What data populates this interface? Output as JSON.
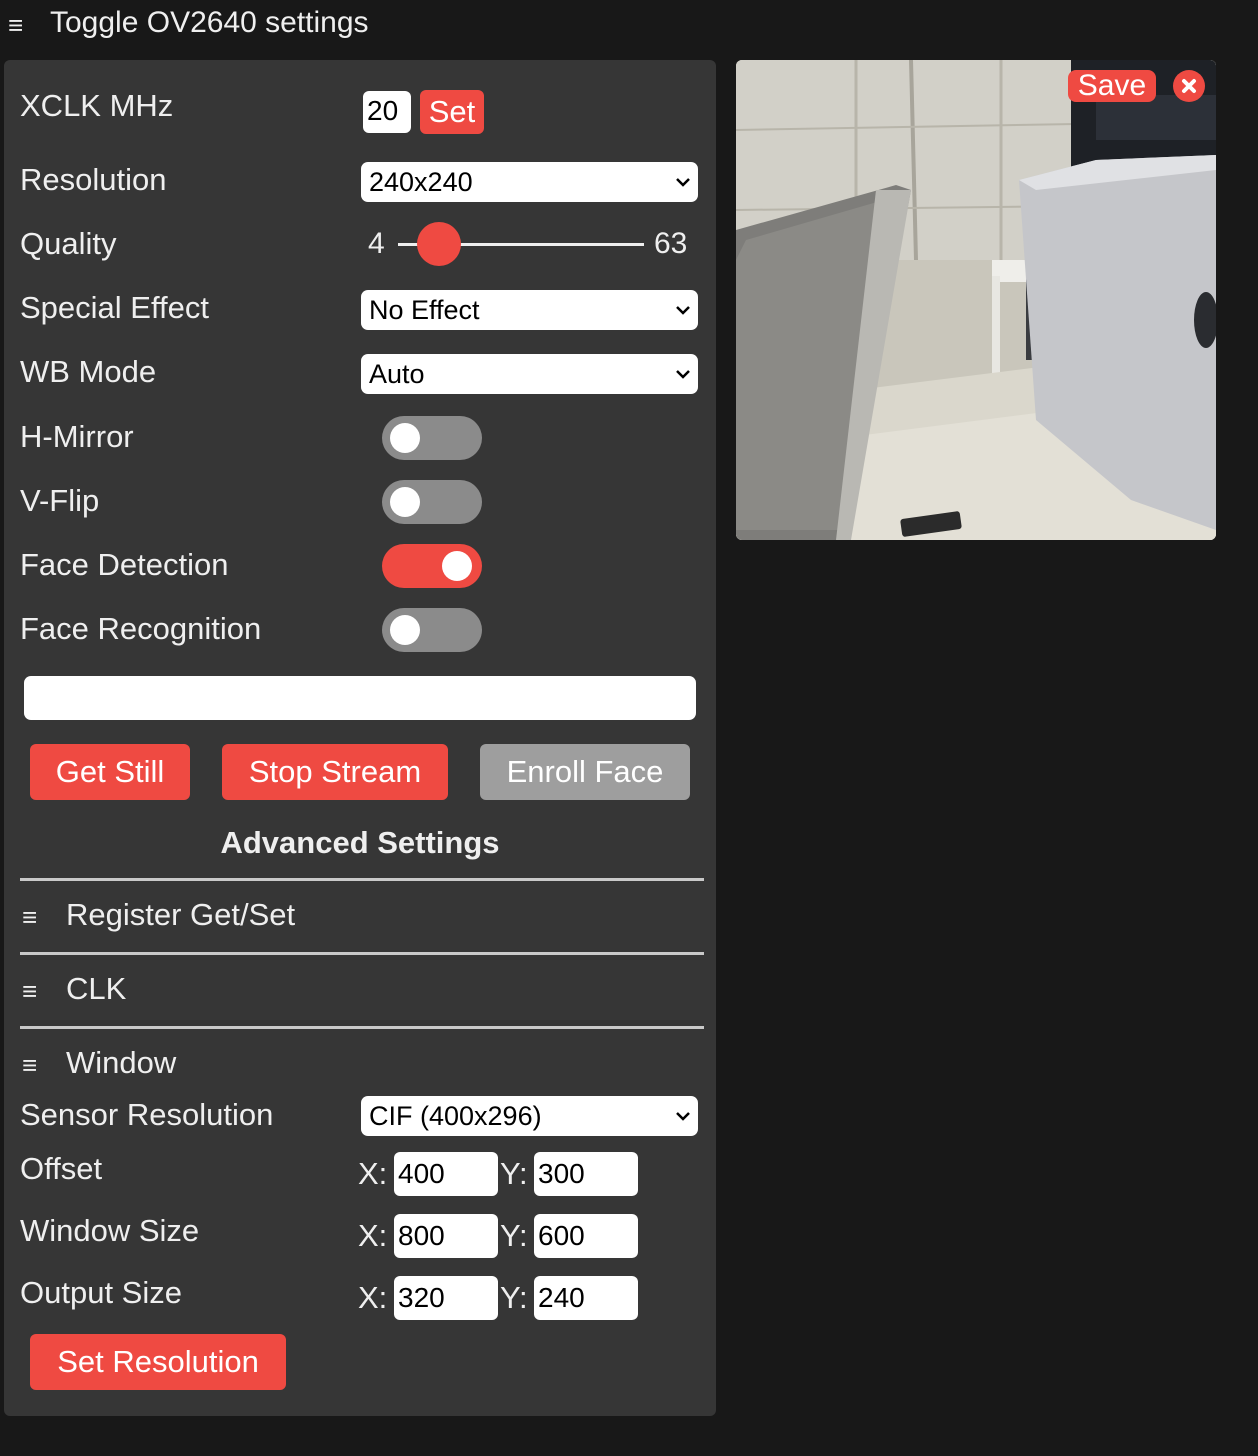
{
  "header": {
    "menu_icon": "hamburger-icon",
    "title": "Toggle OV2640 settings"
  },
  "controls": {
    "xclk": {
      "label": "XCLK MHz",
      "value": "20",
      "button": "Set"
    },
    "resolution": {
      "label": "Resolution",
      "selected": "240x240"
    },
    "quality": {
      "label": "Quality",
      "min": "4",
      "max": "63",
      "value": 4
    },
    "special_effect": {
      "label": "Special Effect",
      "selected": "No Effect"
    },
    "wb_mode": {
      "label": "WB Mode",
      "selected": "Auto"
    },
    "h_mirror": {
      "label": "H-Mirror",
      "on": false
    },
    "v_flip": {
      "label": "V-Flip",
      "on": false
    },
    "face_detection": {
      "label": "Face Detection",
      "on": true
    },
    "face_recognition": {
      "label": "Face Recognition",
      "on": false
    },
    "name_input": {
      "value": ""
    }
  },
  "buttons": {
    "get_still": "Get Still",
    "stop_stream": "Stop Stream",
    "enroll_face": "Enroll Face"
  },
  "advanced": {
    "title": "Advanced Settings",
    "sections": {
      "register": "Register Get/Set",
      "clk": "CLK",
      "window": "Window"
    },
    "window": {
      "sensor_resolution": {
        "label": "Sensor Resolution",
        "selected": "CIF (400x296)"
      },
      "offset": {
        "label": "Offset",
        "x": "400",
        "y": "300"
      },
      "window_size": {
        "label": "Window Size",
        "x": "800",
        "y": "600"
      },
      "output_size": {
        "label": "Output Size",
        "x": "320",
        "y": "240"
      },
      "x_label": "X:",
      "y_label": "Y:",
      "set_button": "Set Resolution"
    }
  },
  "stream": {
    "save_label": "Save",
    "close_icon": "close-icon"
  },
  "colors": {
    "accent": "#ef4a42",
    "panel": "#363636",
    "background": "#181818",
    "disabled_button": "#9e9e9e",
    "toggle_off": "#8b8b8b"
  }
}
